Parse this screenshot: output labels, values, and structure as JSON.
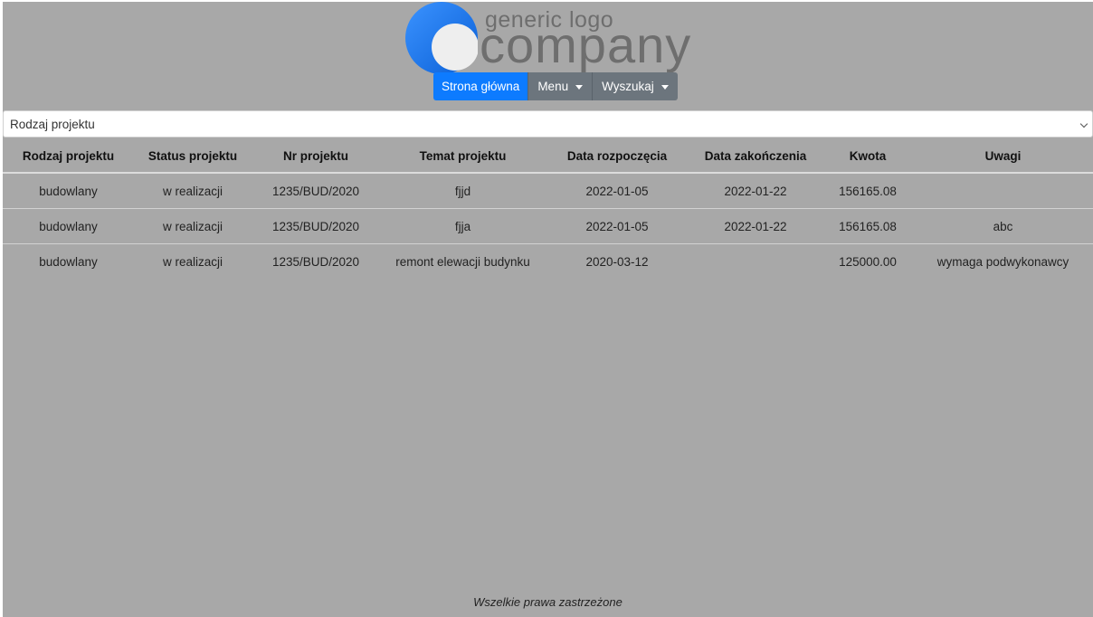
{
  "logo": {
    "line1": "generic logo",
    "line2": "company",
    "colors": {
      "outer": "#1a78f0",
      "inner": "#eeeeee"
    }
  },
  "nav": {
    "home_label": "Strona główna",
    "menu_label": "Menu",
    "search_label": "Wyszukaj",
    "colors": {
      "home": "#0d7bff",
      "other": "#6c757d"
    }
  },
  "filter": {
    "selected": "Rodzaj projektu"
  },
  "table": {
    "headers": [
      "Rodzaj projektu",
      "Status projektu",
      "Nr projektu",
      "Temat projektu",
      "Data rozpoczęcia",
      "Data zakończenia",
      "Kwota",
      "Uwagi"
    ],
    "rows": [
      [
        "budowlany",
        "w realizacji",
        "1235/BUD/2020",
        "fjjd",
        "2022-01-05",
        "2022-01-22",
        "156165.08",
        ""
      ],
      [
        "budowlany",
        "w realizacji",
        "1235/BUD/2020",
        "fjja",
        "2022-01-05",
        "2022-01-22",
        "156165.08",
        "abc"
      ],
      [
        "budowlany",
        "w realizacji",
        "1235/BUD/2020",
        "remont elewacji budynku",
        "2020-03-12",
        "",
        "125000.00",
        "wymaga podwykonawcy"
      ]
    ]
  },
  "footer": {
    "text": "Wszelkie prawa zastrzeżone"
  }
}
